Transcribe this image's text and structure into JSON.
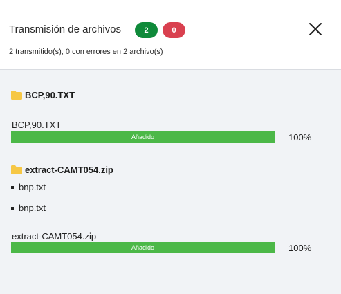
{
  "header": {
    "title": "Transmisión de archivos",
    "success_count": "2",
    "error_count": "0",
    "summary": "2 transmitido(s), 0 con errores en 2 archivo(s)",
    "close_icon": "close-icon"
  },
  "colors": {
    "success": "#0f8a3a",
    "error": "#d9404f",
    "progress": "#4cb848",
    "folder": "#f6c745"
  },
  "files": [
    {
      "folder": "BCP,90.TXT",
      "label": "BCP,90.TXT",
      "status": "Añadido",
      "percent_text": "100%",
      "progress": 1.0
    },
    {
      "folder": "extract-CAMT054.zip",
      "items": [
        "bnp.txt",
        "bnp.txt"
      ],
      "label": "extract-CAMT054.zip",
      "status": "Añadido",
      "percent_text": "100%",
      "progress": 1.0
    }
  ]
}
